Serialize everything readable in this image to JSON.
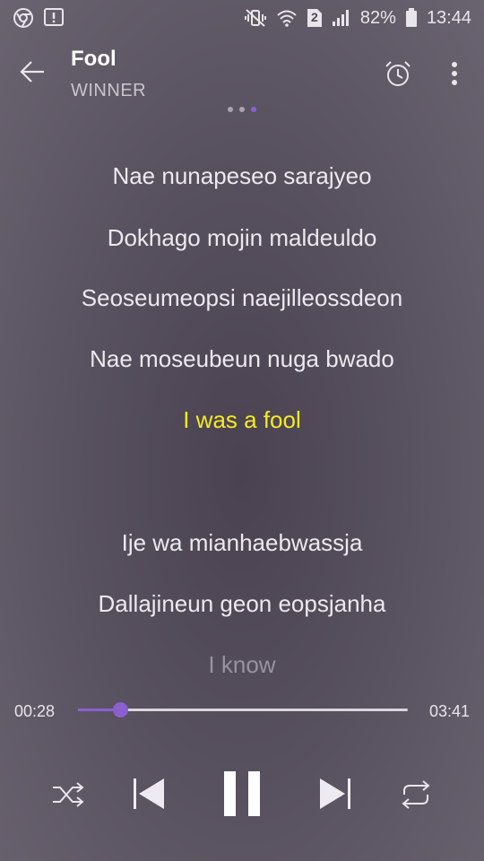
{
  "status_bar": {
    "battery": "82%",
    "time": "13:44",
    "sim": "2"
  },
  "header": {
    "title": "Fool",
    "artist": "WINNER"
  },
  "lyrics": [
    {
      "text": "Nae nunapeseo sarajyeo",
      "state": "normal"
    },
    {
      "text": "Dokhago mojin maldeuldo",
      "state": "normal"
    },
    {
      "text": "Seoseumeopsi naejilleossdeon",
      "state": "normal"
    },
    {
      "text": "Nae moseubeun nuga bwado",
      "state": "normal"
    },
    {
      "text": "I was a fool",
      "state": "current"
    },
    {
      "text": "",
      "state": "normal"
    },
    {
      "text": "Ije wa mianhaebwassja",
      "state": "normal"
    },
    {
      "text": "Dallajineun geon eopsjanha",
      "state": "normal"
    },
    {
      "text": "I know",
      "state": "faded"
    }
  ],
  "player": {
    "current_time": "00:28",
    "total_time": "03:41",
    "progress": 0.127
  },
  "controls": [
    "shuffle-icon",
    "previous-icon",
    "pause-icon",
    "next-icon",
    "repeat-icon"
  ],
  "colors": {
    "accent": "#8b5fd0",
    "current_lyric": "#f5ea23"
  }
}
